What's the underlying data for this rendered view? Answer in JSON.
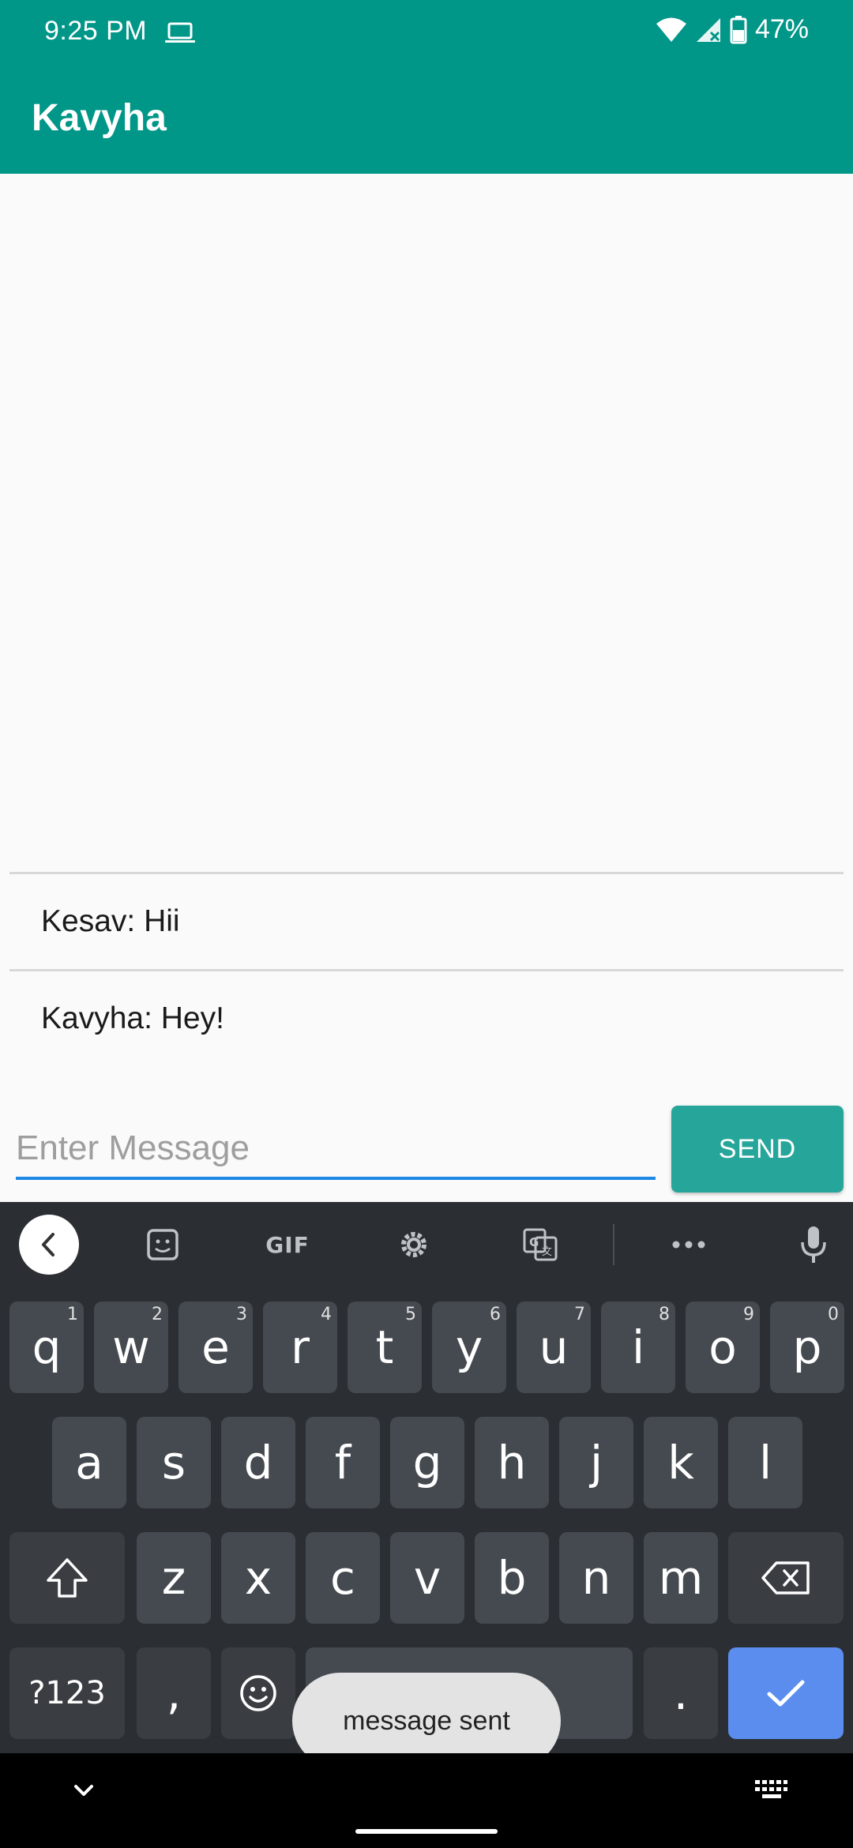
{
  "status_bar": {
    "time": "9:25 PM",
    "battery": "47%",
    "icons": [
      "laptop-icon",
      "wifi-icon",
      "cell-signal-icon",
      "battery-icon"
    ]
  },
  "app_bar": {
    "title": "Kavyha"
  },
  "messages": [
    {
      "text": "Kesav: Hii"
    },
    {
      "text": "Kavyha: Hey!"
    }
  ],
  "composer": {
    "placeholder": "Enter Message",
    "value": "",
    "send_label": "SEND"
  },
  "keyboard": {
    "toolbar": [
      "back-icon",
      "sticker-icon",
      "GIF",
      "gear-icon",
      "translate-icon",
      "more-icon",
      "mic-icon"
    ],
    "gif_label": "GIF",
    "row1": [
      {
        "k": "q",
        "h": "1"
      },
      {
        "k": "w",
        "h": "2"
      },
      {
        "k": "e",
        "h": "3"
      },
      {
        "k": "r",
        "h": "4"
      },
      {
        "k": "t",
        "h": "5"
      },
      {
        "k": "y",
        "h": "6"
      },
      {
        "k": "u",
        "h": "7"
      },
      {
        "k": "i",
        "h": "8"
      },
      {
        "k": "o",
        "h": "9"
      },
      {
        "k": "p",
        "h": "0"
      }
    ],
    "row2": [
      "a",
      "s",
      "d",
      "f",
      "g",
      "h",
      "j",
      "k",
      "l"
    ],
    "row3": [
      "z",
      "x",
      "c",
      "v",
      "b",
      "n",
      "m"
    ],
    "symbols_label": "?123",
    "comma_label": ",",
    "period_label": "."
  },
  "toast": {
    "text": "message sent"
  },
  "colors": {
    "primary": "#009688",
    "send_button": "#26a69a",
    "input_underline": "#1e88e5",
    "keyboard_bg": "#2b2f34",
    "key_bg": "#454a50",
    "enter_key": "#5b8def"
  }
}
